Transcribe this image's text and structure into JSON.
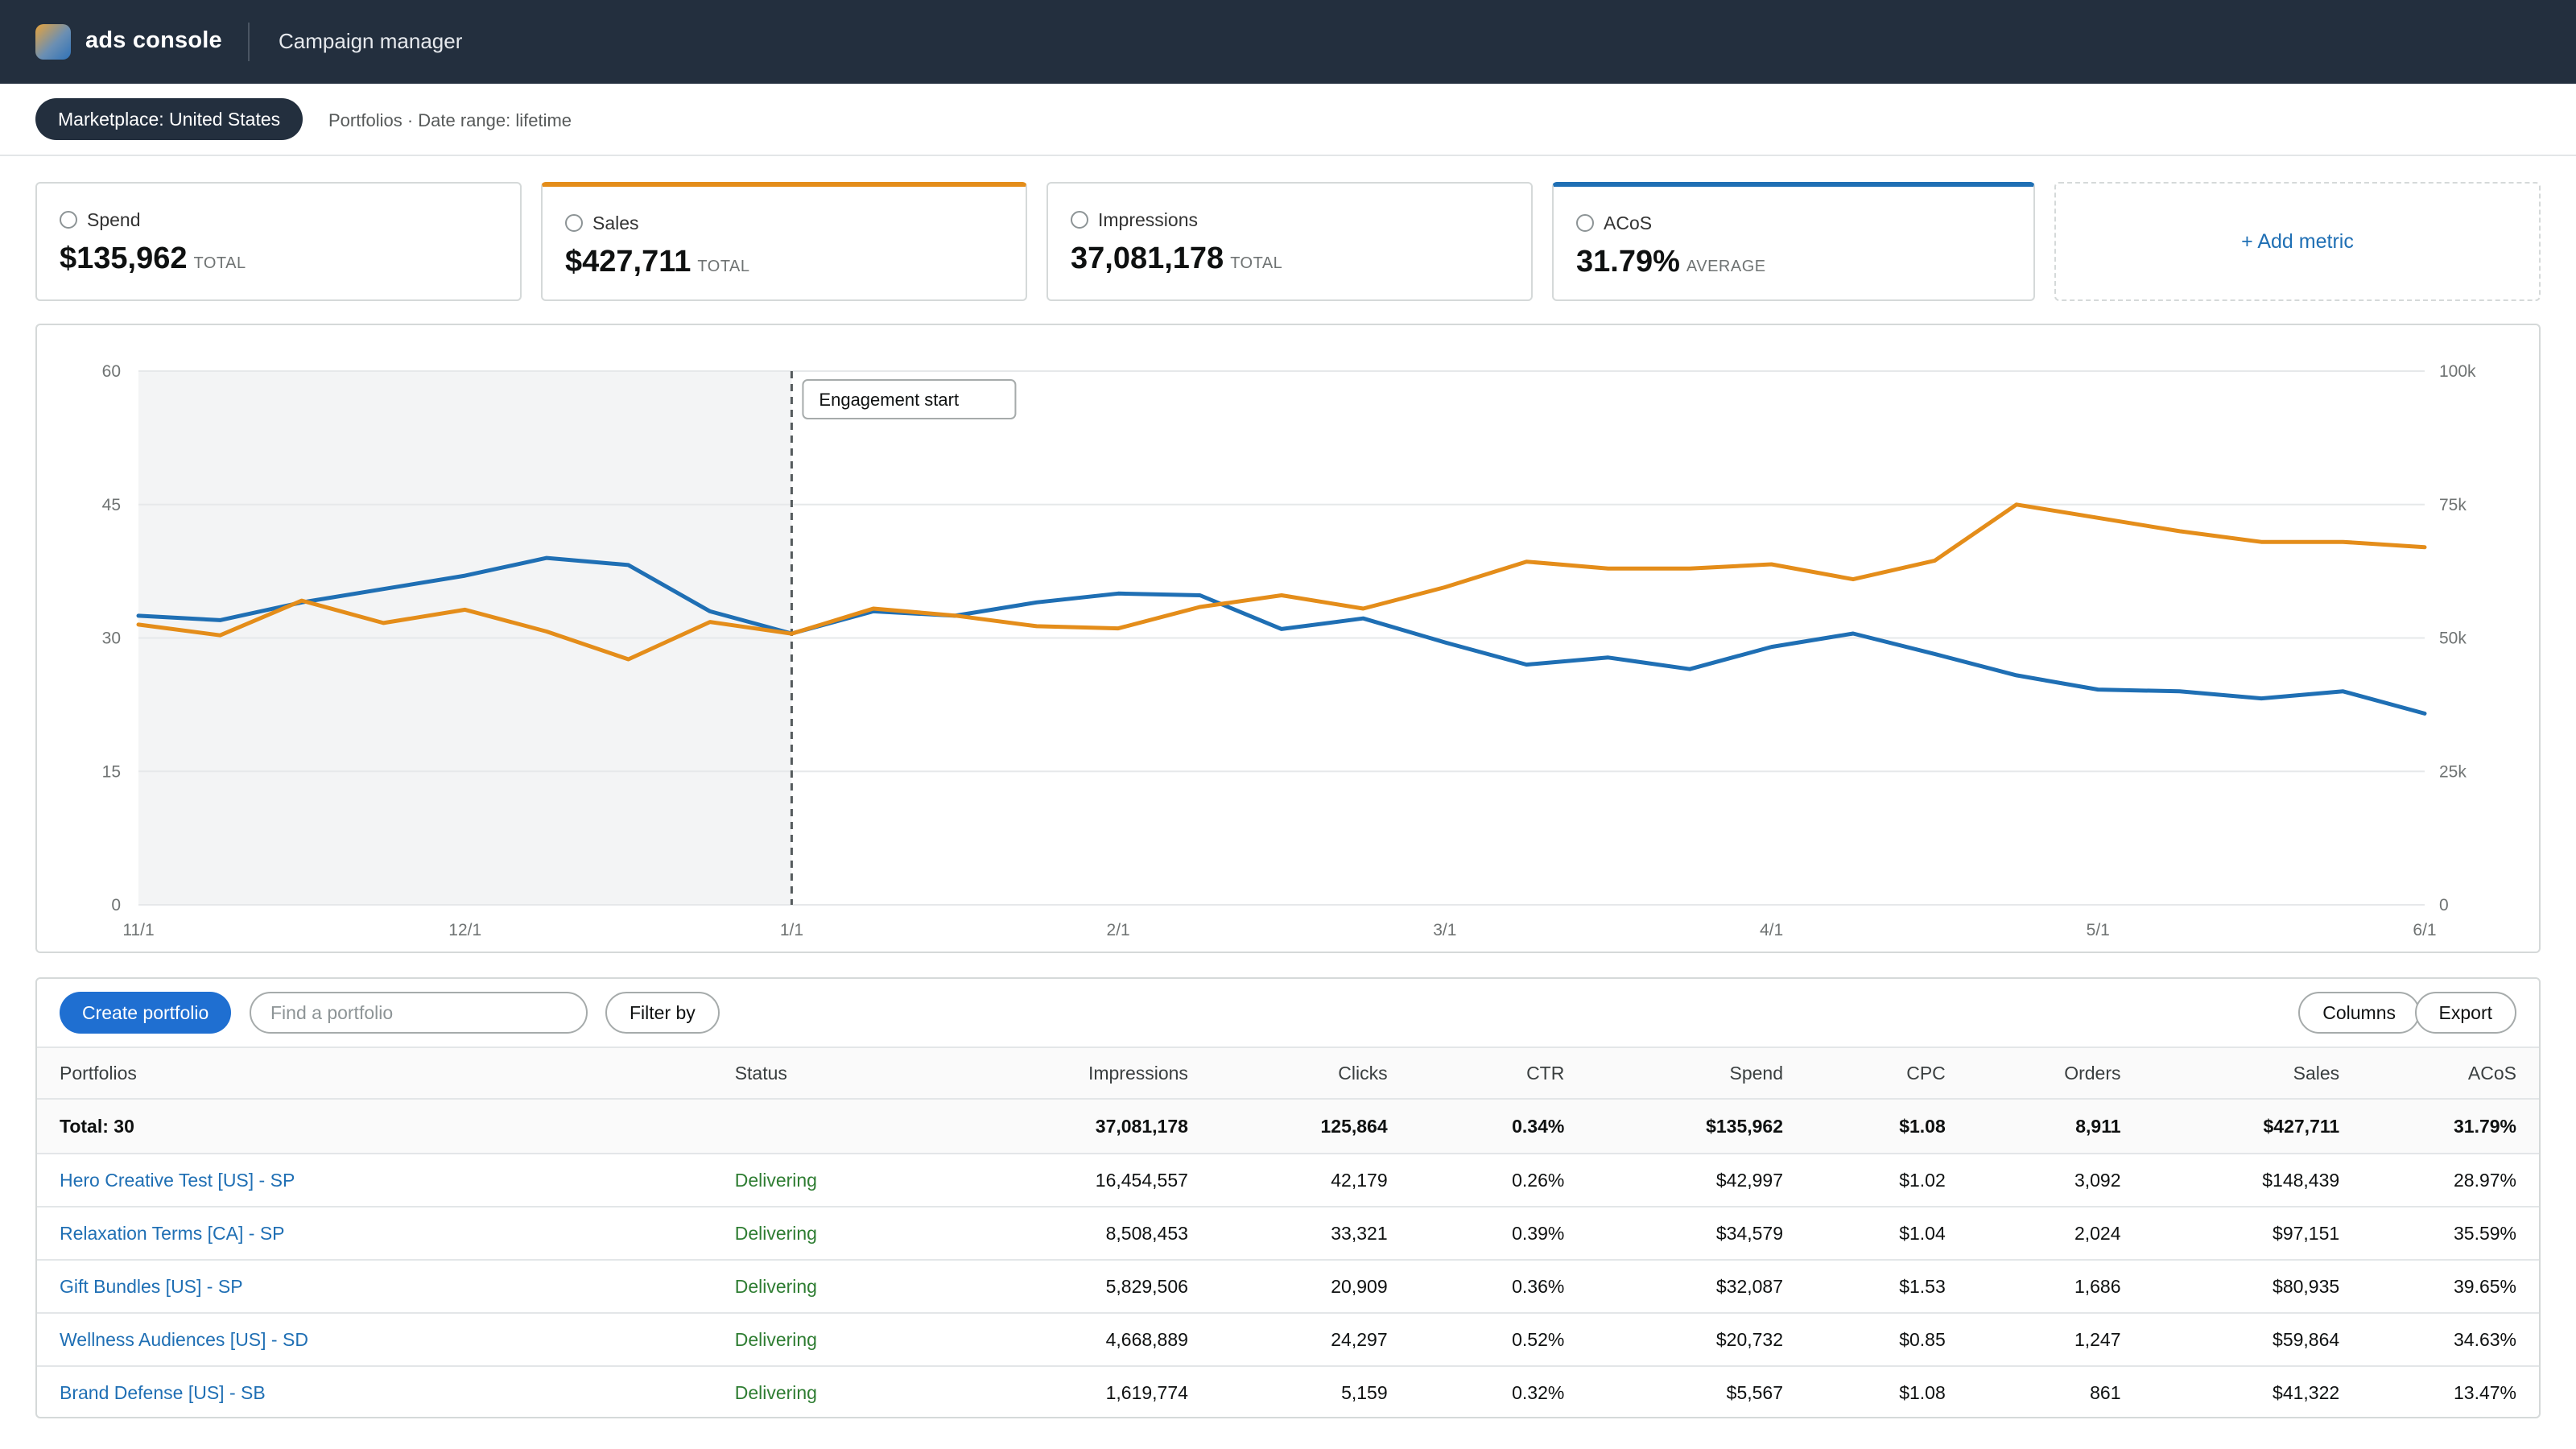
{
  "header": {
    "brand": "ads console",
    "section": "Campaign manager"
  },
  "subbar": {
    "marketplace": "Marketplace: United States",
    "context": "Portfolios · Date range: lifetime"
  },
  "metrics": [
    {
      "label": "Spend",
      "value": "$135,962",
      "suffix": "TOTAL"
    },
    {
      "label": "Sales",
      "value": "$427,711",
      "suffix": "TOTAL"
    },
    {
      "label": "Impressions",
      "value": "37,081,178",
      "suffix": "TOTAL"
    },
    {
      "label": "ACoS",
      "value": "31.79%",
      "suffix": "AVERAGE"
    }
  ],
  "add_metric": "+ Add metric",
  "colors": {
    "orange": "#e48d1a",
    "blue": "#1f6fb4",
    "topbar": "#232f3e",
    "primary_button": "#1f6fd1",
    "status_green": "#2e7d32"
  },
  "chart_data": {
    "type": "line",
    "annotation": "Engagement start",
    "x": [
      "11/1",
      "11/8",
      "11/16",
      "11/23",
      "12/1",
      "12/8",
      "12/16",
      "12/23",
      "1/1",
      "1/8",
      "1/16",
      "1/23",
      "2/1",
      "2/8",
      "2/16",
      "2/23",
      "3/1",
      "3/8",
      "3/16",
      "3/23",
      "4/1",
      "4/8",
      "4/16",
      "4/23",
      "5/1",
      "5/8",
      "5/16",
      "5/23",
      "6/1"
    ],
    "x_ticks": [
      "11/1",
      "12/1",
      "1/1",
      "2/1",
      "3/1",
      "4/1",
      "5/1",
      "6/1"
    ],
    "engagement_index": 8,
    "y_left": {
      "ticks": [
        "0",
        "15",
        "30",
        "45",
        "60"
      ],
      "range": [
        0,
        60
      ]
    },
    "y_right": {
      "ticks": [
        "0",
        "25k",
        "50k",
        "75k",
        "100k"
      ],
      "range": [
        0,
        100000
      ]
    },
    "series": [
      {
        "axis": "left",
        "color": "#1f6fb4",
        "values": [
          32.5,
          32.0,
          34.0,
          35.5,
          37.0,
          39.0,
          38.2,
          33.0,
          30.5,
          33.0,
          32.5,
          34.0,
          35.0,
          34.8,
          31.0,
          32.2,
          29.5,
          27.0,
          27.8,
          26.5,
          29.0,
          30.5,
          28.2,
          25.8,
          24.2,
          24.0,
          23.2,
          24.0,
          21.5
        ]
      },
      {
        "axis": "right",
        "color": "#e48d1a",
        "values": [
          52500,
          50500,
          57000,
          52800,
          55300,
          51200,
          46000,
          53000,
          50800,
          55500,
          54200,
          52200,
          51800,
          55800,
          58000,
          55500,
          59500,
          64300,
          63000,
          63000,
          63800,
          61000,
          64500,
          75000,
          72500,
          70000,
          68000,
          68000,
          67000
        ]
      }
    ]
  },
  "table": {
    "create_label": "Create portfolio",
    "search_placeholder": "Find a portfolio",
    "filter_label": "Filter by",
    "columns_label": "Columns",
    "export_label": "Export",
    "headers": [
      "Portfolios",
      "Status",
      "Impressions",
      "Clicks",
      "CTR",
      "Spend",
      "CPC",
      "Orders",
      "Sales",
      "ACoS"
    ],
    "total": [
      "Total: 30",
      "",
      "37,081,178",
      "125,864",
      "0.34%",
      "$135,962",
      "$1.08",
      "8,911",
      "$427,711",
      "31.79%"
    ],
    "rows": [
      [
        "Hero Creative Test [US] - SP",
        "Delivering",
        "16,454,557",
        "42,179",
        "0.26%",
        "$42,997",
        "$1.02",
        "3,092",
        "$148,439",
        "28.97%"
      ],
      [
        "Relaxation Terms [CA] - SP",
        "Delivering",
        "8,508,453",
        "33,321",
        "0.39%",
        "$34,579",
        "$1.04",
        "2,024",
        "$97,151",
        "35.59%"
      ],
      [
        "Gift Bundles [US] - SP",
        "Delivering",
        "5,829,506",
        "20,909",
        "0.36%",
        "$32,087",
        "$1.53",
        "1,686",
        "$80,935",
        "39.65%"
      ],
      [
        "Wellness Audiences [US] - SD",
        "Delivering",
        "4,668,889",
        "24,297",
        "0.52%",
        "$20,732",
        "$0.85",
        "1,247",
        "$59,864",
        "34.63%"
      ],
      [
        "Brand Defense [US] - SB",
        "Delivering",
        "1,619,774",
        "5,159",
        "0.32%",
        "$5,567",
        "$1.08",
        "861",
        "$41,322",
        "13.47%"
      ]
    ]
  }
}
